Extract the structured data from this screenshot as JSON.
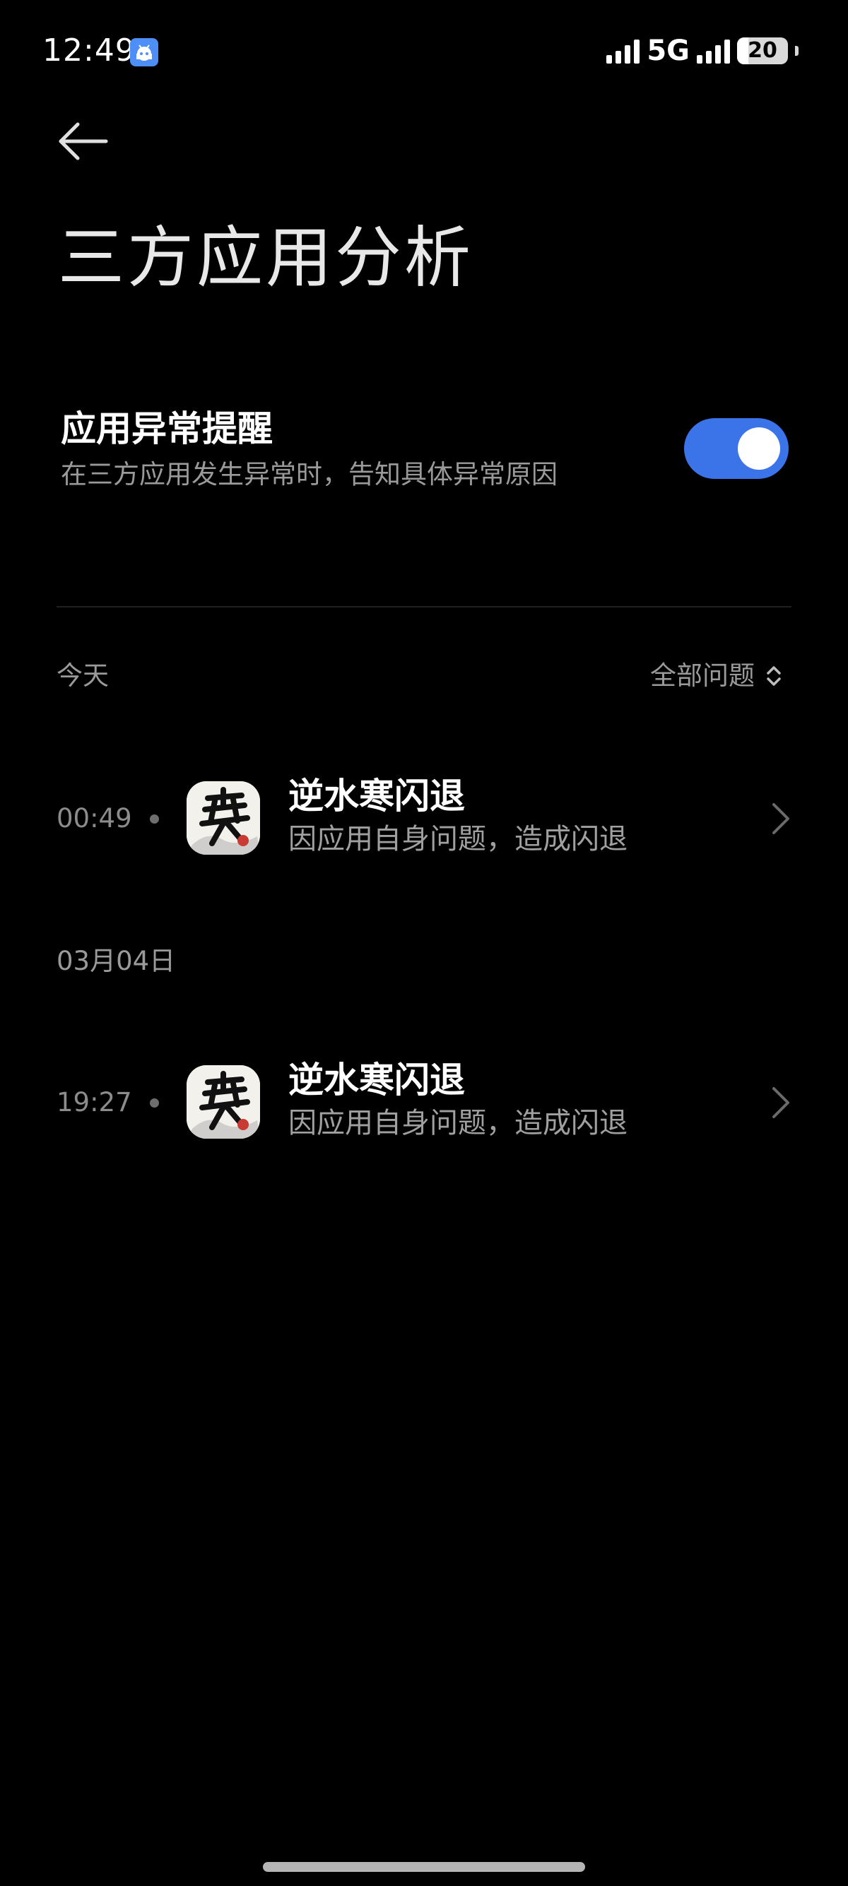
{
  "status_bar": {
    "time": "12:49",
    "network": "5G",
    "battery": "20",
    "app_notification_icon": "android-app-icon"
  },
  "header": {
    "back_icon": "arrow-left-icon",
    "title": "三方应用分析"
  },
  "setting": {
    "title": "应用异常提醒",
    "description": "在三方应用发生异常时，告知具体异常原因",
    "enabled": true,
    "accent_color": "#3b73e8"
  },
  "filter": {
    "label": "全部问题",
    "icon": "sort-updown-icon"
  },
  "sections": [
    {
      "label": "今天",
      "items": [
        {
          "time": "00:49",
          "title": "逆水寒闪退",
          "subtitle": "因应用自身问题，造成闪退",
          "icon": "nishuihan-app-icon"
        }
      ]
    },
    {
      "label": "03月04日",
      "items": [
        {
          "time": "19:27",
          "title": "逆水寒闪退",
          "subtitle": "因应用自身问题，造成闪退",
          "icon": "nishuihan-app-icon"
        }
      ]
    }
  ]
}
